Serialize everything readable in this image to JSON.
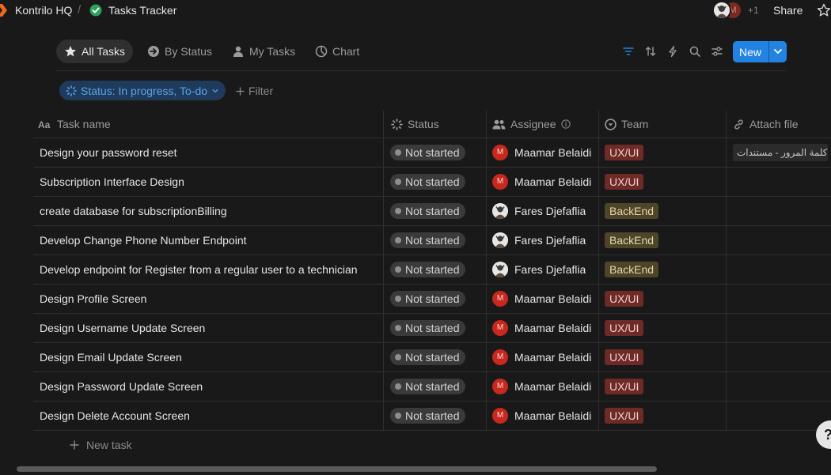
{
  "topbar": {
    "workspace_name": "Kontrilo HQ",
    "breadcrumb_separator": "/",
    "page_title": "Tasks Tracker",
    "collaborators_more": "+1",
    "second_avatar_initial": "M",
    "share_label": "Share"
  },
  "views": {
    "tabs": [
      {
        "label": "All Tasks",
        "icon": "star-icon",
        "active": true
      },
      {
        "label": "By Status",
        "icon": "status-arrow-icon",
        "active": false
      },
      {
        "label": "My Tasks",
        "icon": "person-icon",
        "active": false
      },
      {
        "label": "Chart",
        "icon": "pie-chart-icon",
        "active": false
      }
    ],
    "new_label": "New"
  },
  "filters": {
    "active_filter": "Status: In progress, To-do",
    "add_filter_label": "Filter"
  },
  "table": {
    "columns": {
      "task_name": "Task name",
      "status": "Status",
      "assignee": "Assignee",
      "team": "Team",
      "attach": "Attach file"
    },
    "rows": [
      {
        "task": "Design your password reset",
        "status": "Not started",
        "assignee": "Maamar Belaidi",
        "avatar": "M",
        "team": "UX/UI",
        "file": "إعادة تعيين كلمة المرور - مستندات"
      },
      {
        "task": "Subscription Interface Design",
        "status": "Not started",
        "assignee": "Maamar Belaidi",
        "avatar": "M",
        "team": "UX/UI",
        "file": ""
      },
      {
        "task": "create database for subscriptionBilling",
        "status": "Not started",
        "assignee": "Fares Djefaflia",
        "avatar": "",
        "team": "BackEnd",
        "file": ""
      },
      {
        "task": "Develop Change Phone Number Endpoint",
        "status": "Not started",
        "assignee": "Fares Djefaflia",
        "avatar": "",
        "team": "BackEnd",
        "file": ""
      },
      {
        "task": "Develop endpoint for Register from a regular user to a technician",
        "status": "Not started",
        "assignee": "Fares Djefaflia",
        "avatar": "",
        "team": "BackEnd",
        "file": ""
      },
      {
        "task": "Design Profile Screen",
        "status": "Not started",
        "assignee": "Maamar Belaidi",
        "avatar": "M",
        "team": "UX/UI",
        "file": ""
      },
      {
        "task": "Design Username Update Screen",
        "status": "Not started",
        "assignee": "Maamar Belaidi",
        "avatar": "M",
        "team": "UX/UI",
        "file": ""
      },
      {
        "task": "Design Email Update Screen",
        "status": "Not started",
        "assignee": "Maamar Belaidi",
        "avatar": "M",
        "team": "UX/UI",
        "file": ""
      },
      {
        "task": "Design Password Update Screen",
        "status": "Not started",
        "assignee": "Maamar Belaidi",
        "avatar": "M",
        "team": "UX/UI",
        "file": ""
      },
      {
        "task": "Design Delete Account Screen",
        "status": "Not started",
        "assignee": "Maamar Belaidi",
        "avatar": "M",
        "team": "UX/UI",
        "file": ""
      }
    ],
    "new_task_label": "New task"
  },
  "help_label": "?",
  "colors": {
    "background": "#191919",
    "accent": "#2383e2",
    "tag_uxui": "#6e2a26",
    "tag_backend": "#4e4529",
    "status_done_icon": "#2aa35b"
  }
}
